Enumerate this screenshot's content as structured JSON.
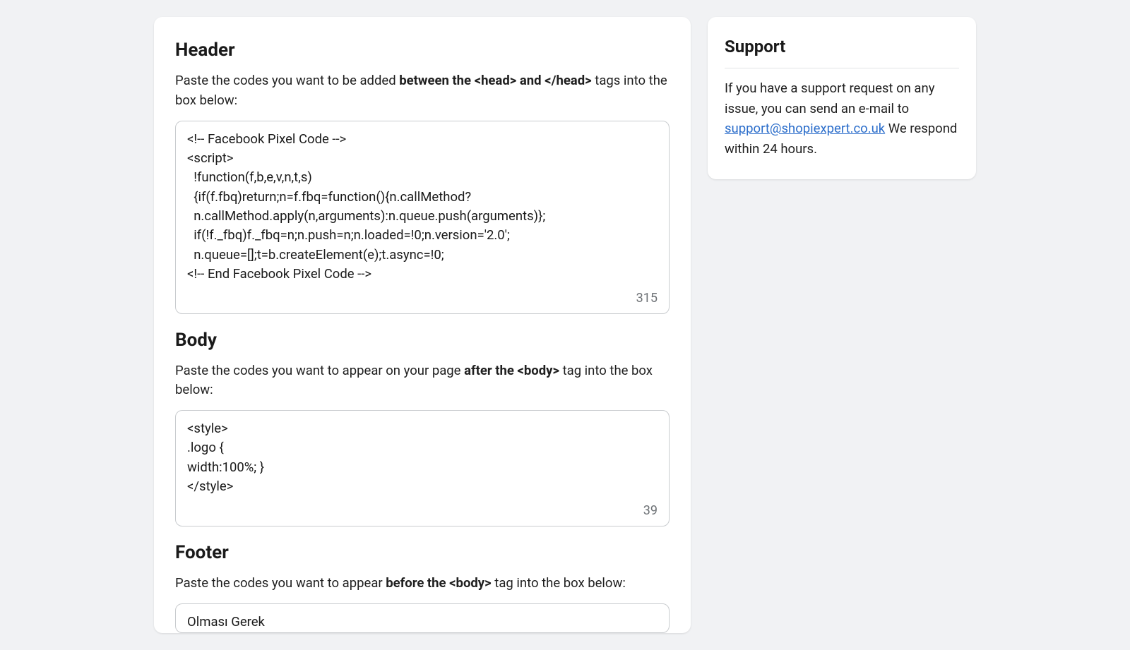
{
  "header": {
    "title": "Header",
    "desc_before": "Paste the codes you want to be added ",
    "desc_bold": "between the <head> and </head>",
    "desc_after": " tags into the box below:",
    "value": "<!-- Facebook Pixel Code -->\n<script>\n  !function(f,b,e,v,n,t,s)\n  {if(f.fbq)return;n=f.fbq=function(){n.callMethod?\n  n.callMethod.apply(n,arguments):n.queue.push(arguments)};\n  if(!f._fbq)f._fbq=n;n.push=n;n.loaded=!0;n.version='2.0';\n  n.queue=[];t=b.createElement(e);t.async=!0;\n<!-- End Facebook Pixel Code -->",
    "count": "315"
  },
  "body_section": {
    "title": "Body",
    "desc_before": "Paste the codes you want to appear on your page ",
    "desc_bold": "after the <body>",
    "desc_after": " tag into the box below:",
    "value": "<style>\n.logo {\nwidth:100%; }\n</style>",
    "count": "39"
  },
  "footer": {
    "title": "Footer",
    "desc_before": "Paste the codes you want to appear ",
    "desc_bold": "before the <body>",
    "desc_after": " tag into the box below:",
    "value": "Olması Gerek"
  },
  "support": {
    "title": "Support",
    "text_before": "If you have a support request on any issue, you can send an e-mail to ",
    "email": "support@shopiexpert.co.uk",
    "text_after": " We respond within 24 hours."
  }
}
